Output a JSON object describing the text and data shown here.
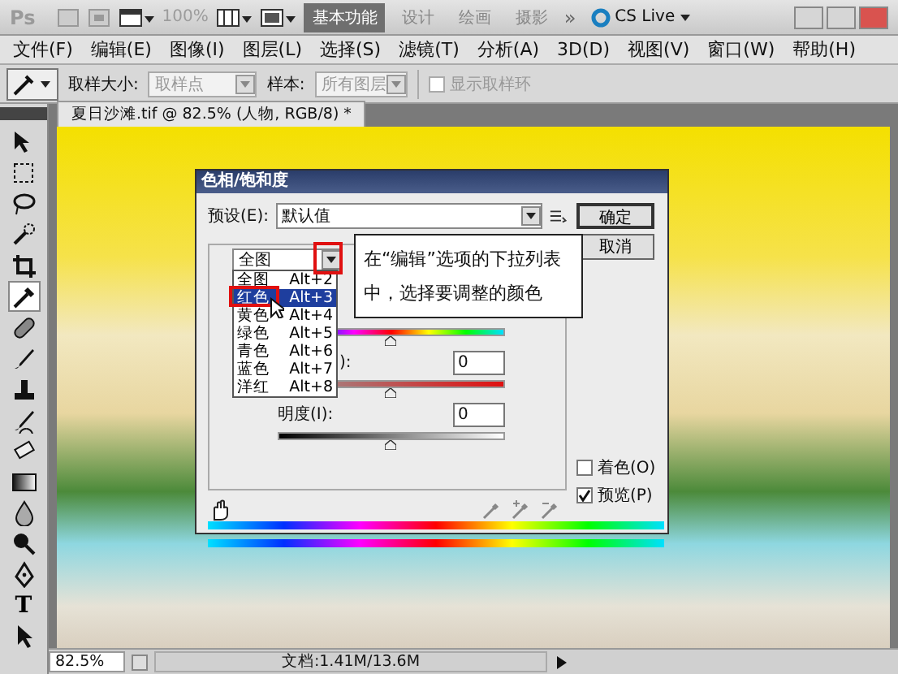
{
  "title_bar": {
    "logo": "Ps",
    "zoom": "100%",
    "workspaces": [
      {
        "label": "基本功能",
        "selected": true
      },
      {
        "label": "设计",
        "selected": false
      },
      {
        "label": "绘画",
        "selected": false
      },
      {
        "label": "摄影",
        "selected": false
      }
    ],
    "more": "»",
    "cs_live": "CS Live"
  },
  "menu": [
    "文件(F)",
    "编辑(E)",
    "图像(I)",
    "图层(L)",
    "选择(S)",
    "滤镜(T)",
    "分析(A)",
    "3D(D)",
    "视图(V)",
    "窗口(W)",
    "帮助(H)"
  ],
  "options_bar": {
    "sample_size_label": "取样大小:",
    "sample_size": "取样点",
    "sample_label": "样本:",
    "sample": "所有图层",
    "show_ring": {
      "label": "显示取样环",
      "checked": false
    }
  },
  "tools": [
    {
      "kind": "move",
      "selected": false
    },
    {
      "kind": "marquee",
      "selected": false
    },
    {
      "kind": "lasso",
      "selected": false
    },
    {
      "kind": "quick-select",
      "selected": false
    },
    {
      "kind": "crop",
      "selected": false
    },
    {
      "kind": "eyedropper",
      "selected": true
    },
    {
      "kind": "healing",
      "selected": false
    },
    {
      "kind": "brush",
      "selected": false
    },
    {
      "kind": "stamp",
      "selected": false
    },
    {
      "kind": "history",
      "selected": false
    },
    {
      "kind": "eraser",
      "selected": false
    },
    {
      "kind": "gradient",
      "selected": false
    },
    {
      "kind": "blur",
      "selected": false
    },
    {
      "kind": "dodge",
      "selected": false
    },
    {
      "kind": "pen",
      "selected": false
    },
    {
      "kind": "text",
      "label": "T",
      "selected": false
    },
    {
      "kind": "path-select",
      "selected": false
    }
  ],
  "document": {
    "tab": "夏日沙滩.tif @ 82.5% (人物, RGB/8) *"
  },
  "dialog": {
    "title": "色相/饱和度",
    "preset_label": "预设(E):",
    "preset": "默认值",
    "buttons": [
      {
        "label": "确定",
        "default": true
      },
      {
        "label": "取消",
        "default": false
      }
    ],
    "edit": "全图",
    "edit_options": [
      {
        "label": "全图",
        "shortcut": "Alt+2",
        "selected": false
      },
      {
        "label": "红色",
        "shortcut": "Alt+3",
        "selected": true
      },
      {
        "label": "黄色",
        "shortcut": "Alt+4",
        "selected": false
      },
      {
        "label": "绿色",
        "shortcut": "Alt+5",
        "selected": false
      },
      {
        "label": "青色",
        "shortcut": "Alt+6",
        "selected": false
      },
      {
        "label": "蓝色",
        "shortcut": "Alt+7",
        "selected": false
      },
      {
        "label": "洋红",
        "shortcut": "Alt+8",
        "selected": false
      }
    ],
    "sliders": [
      {
        "kind": "hue",
        "level": 0.5
      },
      {
        "kind": "saturation",
        "label": "):",
        "value": "0",
        "level": 0.5
      },
      {
        "kind": "lightness",
        "label": "明度(I):",
        "value": "0",
        "level": 0.5
      }
    ],
    "colorize": {
      "label": "着色(O)",
      "checked": false
    },
    "preview": {
      "label": "预览(P)",
      "checked": true
    },
    "callout": "在“编辑”选项的下拉列表中，选择要调整的颜色"
  },
  "status_bar": {
    "zoom": "82.5%",
    "doc_size": "文档:1.41M/13.6M"
  }
}
